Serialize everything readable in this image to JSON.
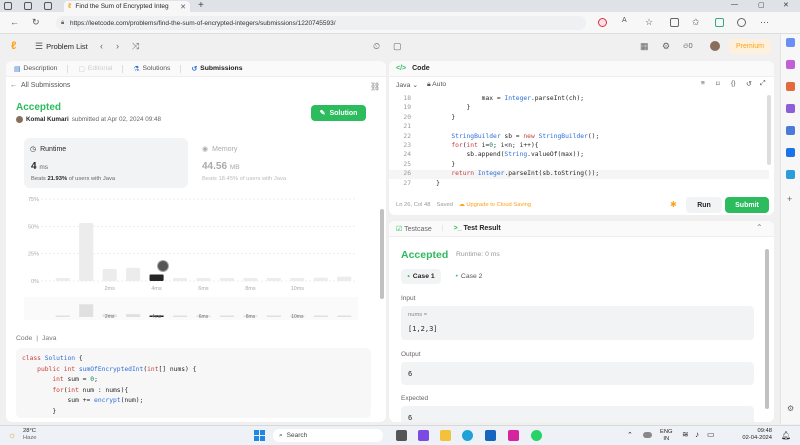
{
  "browser": {
    "tab_title": "Find the Sum of Encrypted Integ",
    "new_tab_glyph": "+",
    "url": "https://leetcode.com/problems/find-the-sum-of-encrypted-integers/submissions/1220745593/",
    "window_controls": [
      "—",
      "▢",
      "✕"
    ]
  },
  "nav": {
    "problem_list": "Problem List",
    "premium": "Premium",
    "counter": "0"
  },
  "left": {
    "tabs": [
      "Description",
      "Editorial",
      "Solutions",
      "Submissions"
    ],
    "all_submissions": "All Submissions",
    "status": "Accepted",
    "user": "Komal Kumari",
    "submitted_at": "submitted at Apr 02, 2024 09:48",
    "solution_button": "Solution",
    "runtime": {
      "label": "Runtime",
      "value": "4",
      "unit": "ms",
      "beats_prefix": "Beats ",
      "beats_pct": "21.93%",
      "beats_suffix": " of users with Java"
    },
    "memory": {
      "label": "Memory",
      "value": "44.56",
      "unit": "MB",
      "beats_prefix": "Beats ",
      "beats_pct": "18.45%",
      "beats_suffix": " of users with Java"
    },
    "code_label": "Code",
    "code_lang": "Java",
    "code_lines": [
      "class Solution {",
      "    public int sumOfEncryptedInt(int[] nums) {",
      "        int sum = 0;",
      "        for(int num : nums){",
      "            sum += encrypt(num);",
      "        }"
    ]
  },
  "chart_data": {
    "type": "bar",
    "ylabel": "",
    "xlabel": "",
    "y_ticks": [
      "75%",
      "50%",
      "25%",
      "0%"
    ],
    "ylim": [
      0,
      75
    ],
    "categories": [
      "0ms",
      "1ms",
      "2ms",
      "3ms",
      "4ms",
      "5ms",
      "6ms",
      "7ms",
      "8ms",
      "9ms",
      "10ms",
      "11ms",
      "12ms"
    ],
    "x_tick_labels": [
      "2ms",
      "4ms",
      "6ms",
      "8ms",
      "10ms"
    ],
    "values": [
      2,
      53,
      11,
      12,
      6,
      2,
      2,
      2,
      2,
      2,
      2,
      3,
      4
    ],
    "highlight_index": 4,
    "grid": true,
    "minimap_labels": [
      "2ms",
      "4ms",
      "6ms",
      "8ms",
      "10ms"
    ]
  },
  "editor": {
    "header": "Code",
    "lang": "Java",
    "auto": "Auto",
    "lines": [
      {
        "n": "18",
        "t": "                max = Integer.parseInt(ch);"
      },
      {
        "n": "19",
        "t": "            }"
      },
      {
        "n": "20",
        "t": "        }"
      },
      {
        "n": "21",
        "t": ""
      },
      {
        "n": "22",
        "t": "        StringBuilder sb = new StringBuilder();"
      },
      {
        "n": "23",
        "t": "        for(int i=0; i<n; i++){"
      },
      {
        "n": "24",
        "t": "            sb.append(String.valueOf(max));"
      },
      {
        "n": "25",
        "t": "        }"
      },
      {
        "n": "26",
        "t": "        return Integer.parseInt(sb.toString());"
      },
      {
        "n": "27",
        "t": "    }"
      }
    ],
    "status_pos": "Ln 26, Col 48",
    "status_saved": "Saved",
    "upgrade": "Upgrade to Cloud Saving",
    "run": "Run",
    "submit": "Submit"
  },
  "result": {
    "tab_testcase": "Testcase",
    "tab_result": "Test Result",
    "status": "Accepted",
    "runtime": "Runtime: 0 ms",
    "case1": "Case 1",
    "case2": "Case 2",
    "input_label": "Input",
    "nums_label": "nums =",
    "nums_value": "[1,2,3]",
    "output_label": "Output",
    "output_value": "6",
    "expected_label": "Expected",
    "expected_value": "6"
  },
  "taskbar": {
    "temp": "28°C",
    "weather": "Haze",
    "search": "Search",
    "lang1": "ENG",
    "lang2": "IN",
    "time": "09:48",
    "date": "02-04-2024"
  }
}
